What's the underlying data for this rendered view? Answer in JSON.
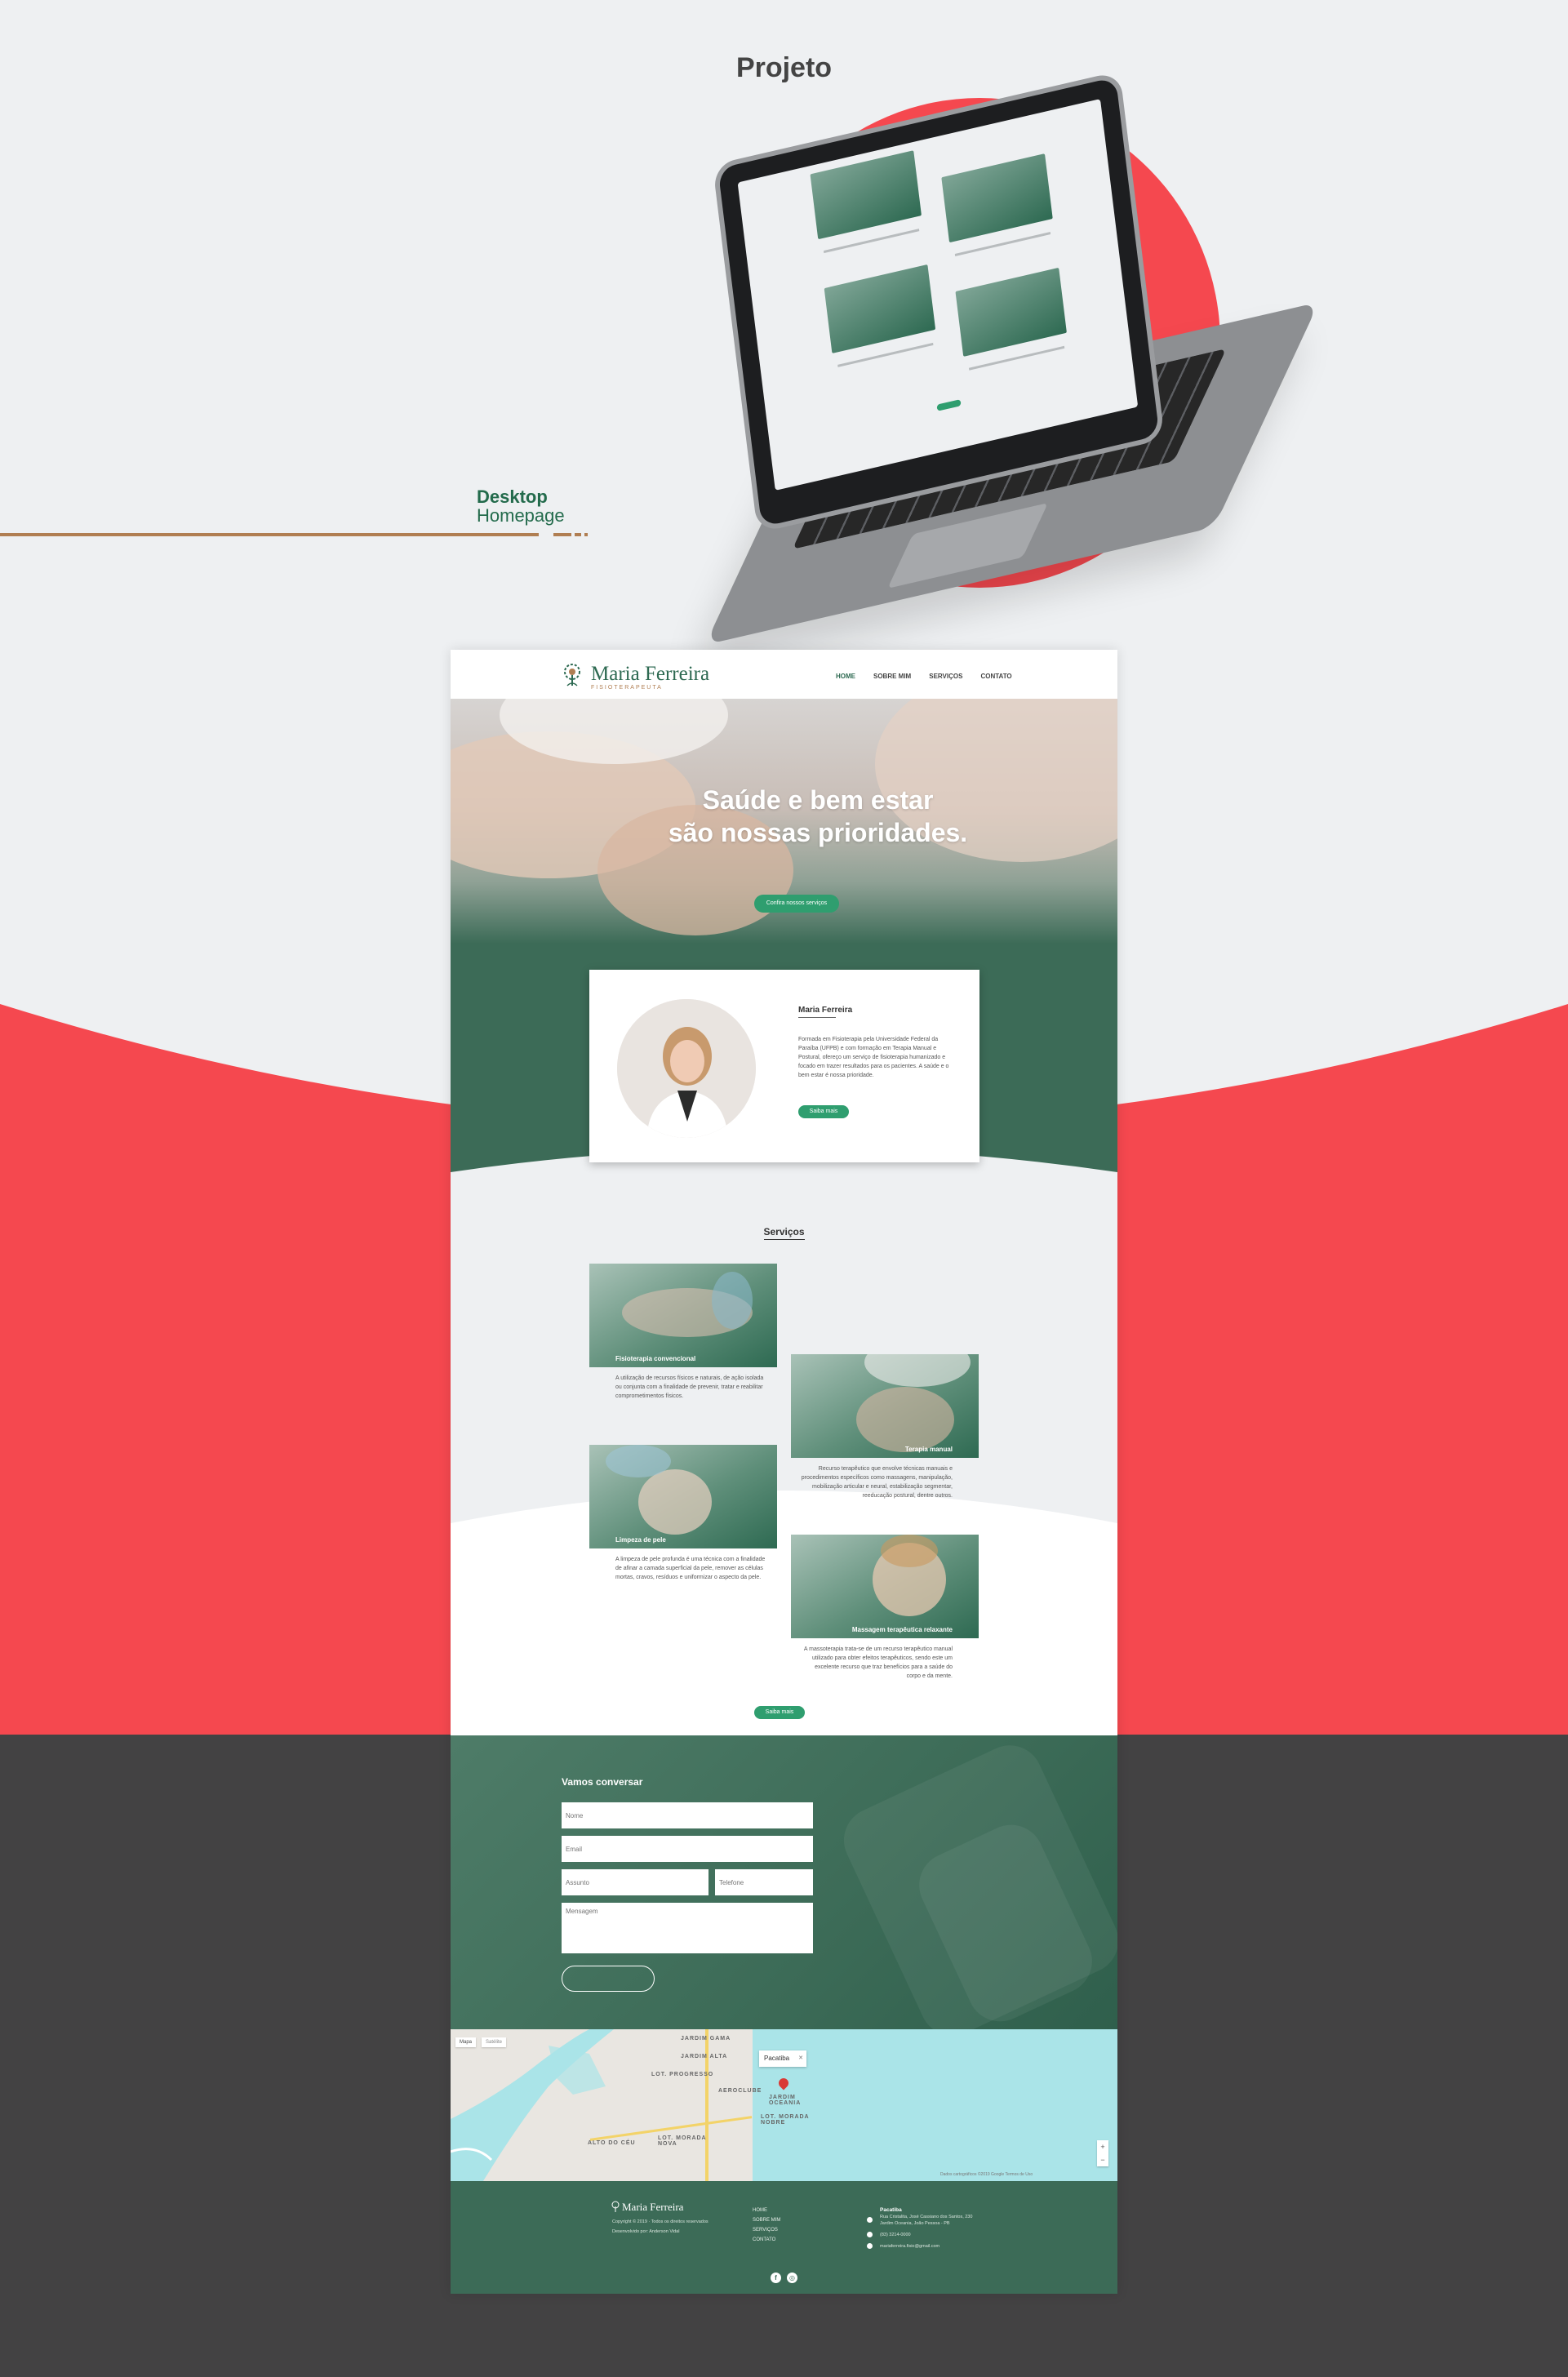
{
  "presentation": {
    "heading": "Projeto",
    "caption_bold": "Desktop",
    "caption_light": "Homepage"
  },
  "colors": {
    "accent_red": "#f5484f",
    "brand_green": "#3c6b57",
    "button_green": "#2f9e6f",
    "gold": "#b07e52",
    "dark_bg": "#434243",
    "light_bg": "#eef0f2"
  },
  "site": {
    "brand": {
      "name": "Maria Ferreira",
      "subtitle": "FISIOTERAPEUTA",
      "icon": "tree-logo-icon"
    },
    "nav": {
      "items": [
        "HOME",
        "SOBRE MIM",
        "SERVIÇOS",
        "CONTATO"
      ],
      "active": "HOME"
    },
    "hero": {
      "line1": "Saúde e bem estar",
      "line2": "são nossas prioridades.",
      "button": "Confira nossos serviços"
    },
    "about": {
      "name": "Maria Ferreira",
      "text": "Formada em Fisioterapia pela Universidade Federal da Paraíba (UFPB) e com formação em Terapia Manual e Postural, ofereço um serviço de fisioterapia humanizado e focado em trazer resultados para os pacientes. A saúde e o bem estar é nossa prioridade.",
      "button": "Saiba mais"
    },
    "services": {
      "title": "Serviços",
      "items": [
        {
          "label": "Fisioterapia convencional",
          "text": "A utilização de recursos físicos e naturais, de ação isolada ou conjunta com a finalidade de prevenir, tratar e reabilitar comprometimentos físicos."
        },
        {
          "label": "Terapia manual",
          "text": "Recurso terapêutico que envolve técnicas manuais e procedimentos específicos como massagens, manipulação, mobilização articular e neural, estabilização segmentar, reeducação postural, dentre outros."
        },
        {
          "label": "Limpeza de pele",
          "text": "A limpeza de pele profunda é uma técnica com a finalidade de afinar a camada superficial da pele, remover as células mortas, cravos, resíduos e uniformizar o aspecto da pele."
        },
        {
          "label": "Massagem terapêutica relaxante",
          "text": "A massoterapia trata-se de um recurso terapêutico manual utilizado para obter efeitos terapêuticos, sendo este um excelente recurso que traz benefícios para a saúde do corpo e da mente."
        }
      ],
      "button": "Saiba mais"
    },
    "contact": {
      "title": "Vamos conversar",
      "placeholders": {
        "name": "Nome",
        "email": "Email",
        "subject": "Assunto",
        "phone": "Telefone",
        "message": "Mensagem"
      }
    },
    "map": {
      "tab_map": "Mapa",
      "tab_satellite": "Satélite",
      "info": "Pacatiba",
      "info_close": "✕",
      "labels": [
        "JARDIM GAMA",
        "JARDIM ALTA",
        "LOT. PROGRESSO",
        "AEROCLUBE",
        "JARDIM OCEANIA",
        "LOT. MORADA NOBRE",
        "LOT. MORADA NOVA",
        "ALTO DO CÉU"
      ],
      "zoom_in": "+",
      "zoom_out": "−",
      "legal": "Dados cartográficos ©2019 Google   Termos de Uso"
    },
    "footer": {
      "brand": "Maria Ferreira",
      "copyright": "Copyright © 2019 · Todos os direitos reservados",
      "developer": "Desenvolvido por: Anderson Vidal",
      "nav": [
        "HOME",
        "SOBRE MIM",
        "SERVIÇOS",
        "CONTATO"
      ],
      "contact_title": "Pacatiba",
      "address_line1": "Rua Cristalita, José Cassiano dos Santos, 230",
      "address_line2": "Jardim Oceania, João Pessoa - PB",
      "phone": "(83) 3214-0000",
      "email": "mariaferreira.fisio@gmail.com",
      "social": [
        "facebook-icon",
        "instagram-icon"
      ]
    }
  }
}
